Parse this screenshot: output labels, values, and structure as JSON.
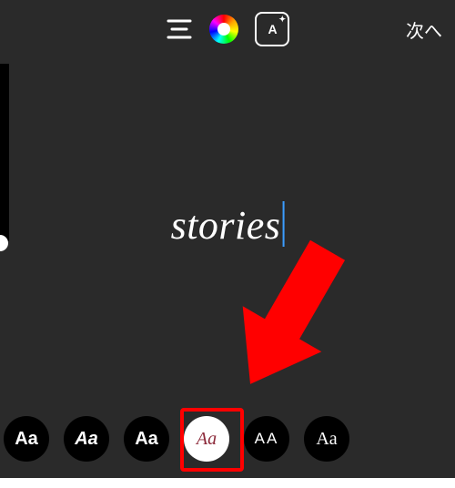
{
  "topbar": {
    "next_label": "次へ",
    "effects_label": "A",
    "effects_star": "✦"
  },
  "text_input": {
    "value": "stories"
  },
  "fonts": {
    "f1": "Aa",
    "f2": "Aa",
    "f3": "Aa",
    "f4": "Aa",
    "f5": "AA",
    "f6": "Aa"
  }
}
